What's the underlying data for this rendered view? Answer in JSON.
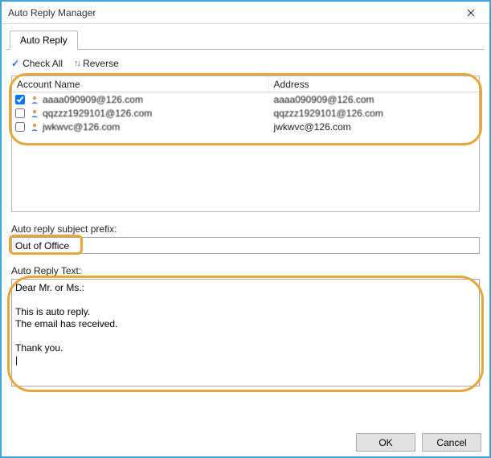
{
  "window": {
    "title": "Auto Reply Manager"
  },
  "tabs": {
    "auto_reply": "Auto Reply"
  },
  "toolbar": {
    "check_all": "Check All",
    "reverse": "Reverse"
  },
  "list": {
    "col_account": "Account Name",
    "col_address": "Address",
    "rows": [
      {
        "checked": true,
        "account": "aaaa090909@126.com",
        "address": "aaaa090909@126.com"
      },
      {
        "checked": false,
        "account": "qqzzz1929101@126.com",
        "address": "qqzzz1929101@126.com"
      },
      {
        "checked": false,
        "account": "jwkwvc@126.com",
        "address": "jwkwvc@126.com"
      }
    ]
  },
  "subject": {
    "label": "Auto reply subject prefix:",
    "value": "Out of Office"
  },
  "reply_text": {
    "label": "Auto Reply Text:",
    "value": "Dear Mr. or Ms.:\n\nThis is auto reply.\nThe email has received.\n\nThank you.\n|"
  },
  "buttons": {
    "ok": "OK",
    "cancel": "Cancel"
  }
}
